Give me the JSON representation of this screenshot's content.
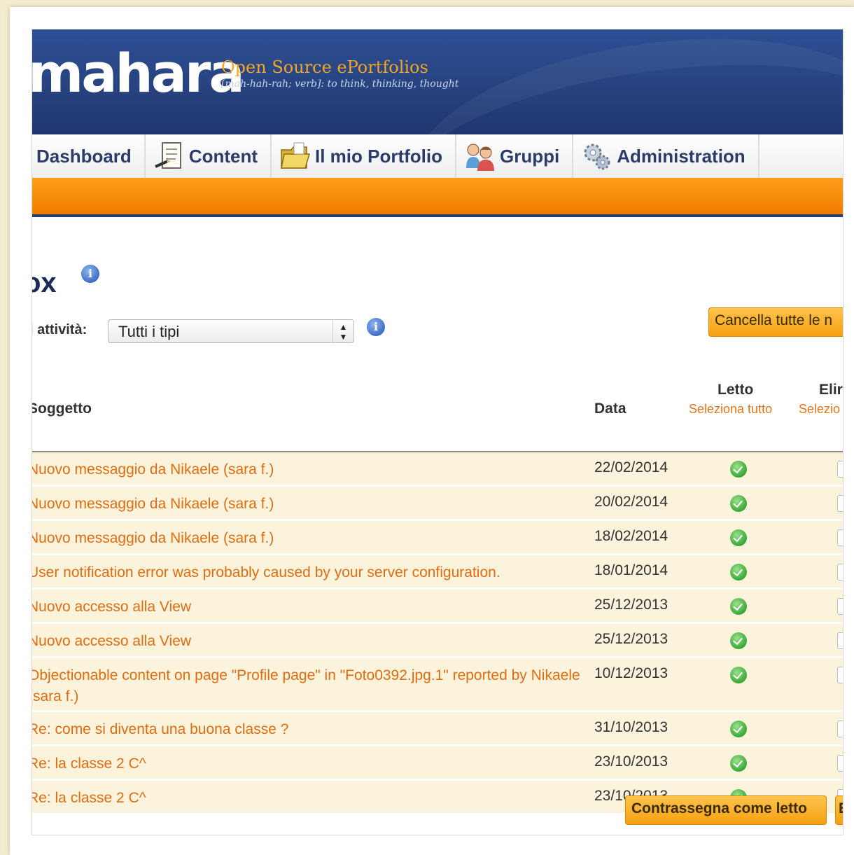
{
  "header": {
    "logo": "mahara",
    "tagline": "Open Source ePortfolios",
    "tagline_sub": "[mah-hah-rah; verb]: to think, thinking, thought"
  },
  "nav": {
    "items": [
      {
        "label": "Dashboard",
        "icon": "dashboard-icon"
      },
      {
        "label": "Content",
        "icon": "notepad-icon"
      },
      {
        "label": "Il mio Portfolio",
        "icon": "folder-icon"
      },
      {
        "label": "Gruppi",
        "icon": "people-icon"
      },
      {
        "label": "Administration",
        "icon": "gears-icon"
      }
    ]
  },
  "page": {
    "title": "ox",
    "filter_label": "i attività:",
    "filter_value": "Tutti i tipi",
    "delete_all_button": "Cancella tutte le n",
    "mark_read_button": "Contrassegna come letto",
    "second_button": "E"
  },
  "table": {
    "col_subject": "Soggetto",
    "col_date": "Data",
    "col_read": "Letto",
    "col_read_select": "Seleziona tutto",
    "col_delete": "Elir",
    "col_delete_select": "Selezio",
    "rows": [
      {
        "subject": "Nuovo messaggio da Nikaele (sara f.)",
        "date": "22/02/2014"
      },
      {
        "subject": "Nuovo messaggio da Nikaele (sara f.)",
        "date": "20/02/2014"
      },
      {
        "subject": "Nuovo messaggio da Nikaele (sara f.)",
        "date": "18/02/2014"
      },
      {
        "subject": "User notification error was probably caused by your server configuration.",
        "date": "18/01/2014"
      },
      {
        "subject": "Nuovo accesso alla View",
        "date": "25/12/2013"
      },
      {
        "subject": "Nuovo accesso alla View",
        "date": "25/12/2013"
      },
      {
        "subject": "Objectionable content on page \"Profile page\" in \"Foto0392.jpg.1\" reported by Nikaele (sara f.)",
        "date": "10/12/2013"
      },
      {
        "subject": "Re: come si diventa una buona classe ?",
        "date": "31/10/2013"
      },
      {
        "subject": "Re: la classe 2 C^",
        "date": "23/10/2013"
      },
      {
        "subject": "Re: la classe 2 C^",
        "date": "23/10/2013"
      }
    ]
  },
  "colors": {
    "header_blue": "#2b4a8e",
    "nav_orange": "#f7860a",
    "link_orange": "#e06c10",
    "row_bg": "#fcf3dc",
    "read_green": "#3aa836"
  }
}
